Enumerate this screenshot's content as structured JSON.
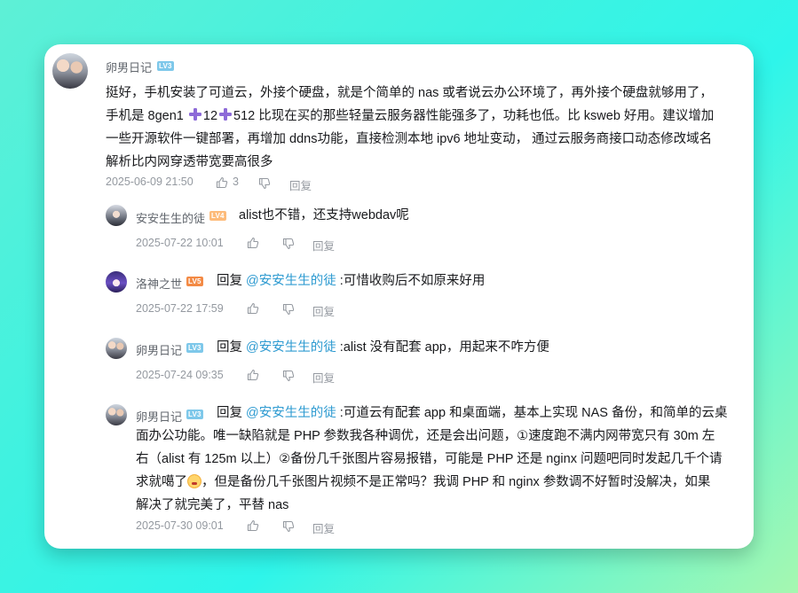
{
  "main_comment": {
    "username": "卵男日记",
    "level": "LV3",
    "text_part1": "挺好，手机安装了可道云，外接个硬盘，就是个简单的 nas 或者说云办公环境了，再外接个硬盘就够用了，",
    "text_part2a": "手机是 8gen1 ",
    "text_part2b": "12",
    "text_part2c": "512 比现在买的那些轻量云服务器性能强多了，功耗也低。比 ksweb 好用。建议增加",
    "text_part3": "一些开源软件一键部署，再增加 ddns功能，直接检测本地 ipv6 地址变动，  通过云服务商接口动态修改域名",
    "text_part4": "解析比内网穿透带宽要高很多",
    "time": "2025-06-09 21:50",
    "likes": "3",
    "reply_label": "回复"
  },
  "replies": [
    {
      "username": "安安生生的徒",
      "level": "LV4",
      "reply_kw": "",
      "mention": "",
      "text": "alist也不错，还支持webdav呢",
      "time": "2025-07-22 10:01",
      "reply_label": "回复"
    },
    {
      "username": "洛神之世",
      "level": "LV5",
      "reply_kw": "回复 ",
      "mention": "@安安生生的徒",
      "text": " :可惜收购后不如原来好用",
      "time": "2025-07-22 17:59",
      "reply_label": "回复"
    },
    {
      "username": "卵男日记",
      "level": "LV3",
      "reply_kw": "回复 ",
      "mention": "@安安生生的徒",
      "text": " :alist 没有配套 app，用起来不咋方便",
      "time": "2025-07-24 09:35",
      "reply_label": "回复"
    },
    {
      "username": "卵男日记",
      "level": "LV3",
      "reply_kw": "回复 ",
      "mention": "@安安生生的徒",
      "text_line1": " :可道云有配套 app 和桌面端，基本上实现 NAS 备份，和简单的云桌",
      "text_line2": "面办公功能。唯一缺陷就是 PHP 参数我各种调优，还是会出问题，①速度跑不满内网带宽只有 30m 左",
      "text_line3": "右（alist 有 125m 以上）②备份几千张图片容易报错，可能是 PHP 还是 nginx 问题吧同时发起几千个请",
      "text_line4a": "求就噶了",
      "text_line4b": "，但是备份几千张图片视频不是正常吗？我调 PHP 和 nginx 参数调不好暂时没解决，如果",
      "text_line5": "解决了就完美了，平替 nas",
      "time": "2025-07-30 09:01",
      "reply_label": "回复"
    }
  ],
  "colors": {
    "mention": "#2f9bd1",
    "meta": "#9499a0",
    "plus_emoji": "#8d6ad8"
  },
  "icons": [
    "thumb-up-icon",
    "thumb-down-icon",
    "plus-emoji-icon",
    "surprised-emoji-icon"
  ]
}
